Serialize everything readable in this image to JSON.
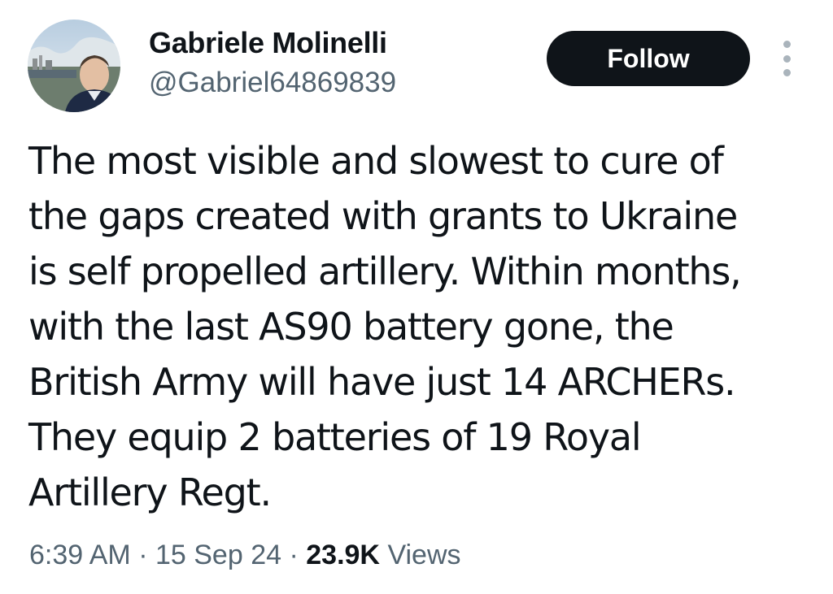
{
  "author": {
    "display_name": "Gabriele Molinelli",
    "handle": "@Gabriel64869839"
  },
  "actions": {
    "follow_label": "Follow",
    "more_icon": "more-vertical-icon"
  },
  "tweet": {
    "lines": [
      "The most visible and slowest to cure of",
      "the gaps created with grants to Ukraine",
      "is self propelled artillery. Within months,",
      "with the last AS90 battery gone, the",
      "British Army will have just 14 ARCHERs.",
      "They equip 2 batteries of 19 Royal",
      "Artillery Regt."
    ]
  },
  "meta": {
    "time": "6:39 AM",
    "separator": "·",
    "date": "15 Sep 24",
    "views_count": "23.9K",
    "views_label": "Views"
  },
  "colors": {
    "text_primary": "#0f1419",
    "text_secondary": "#536471",
    "follow_bg": "#0f1419",
    "follow_text": "#ffffff"
  }
}
